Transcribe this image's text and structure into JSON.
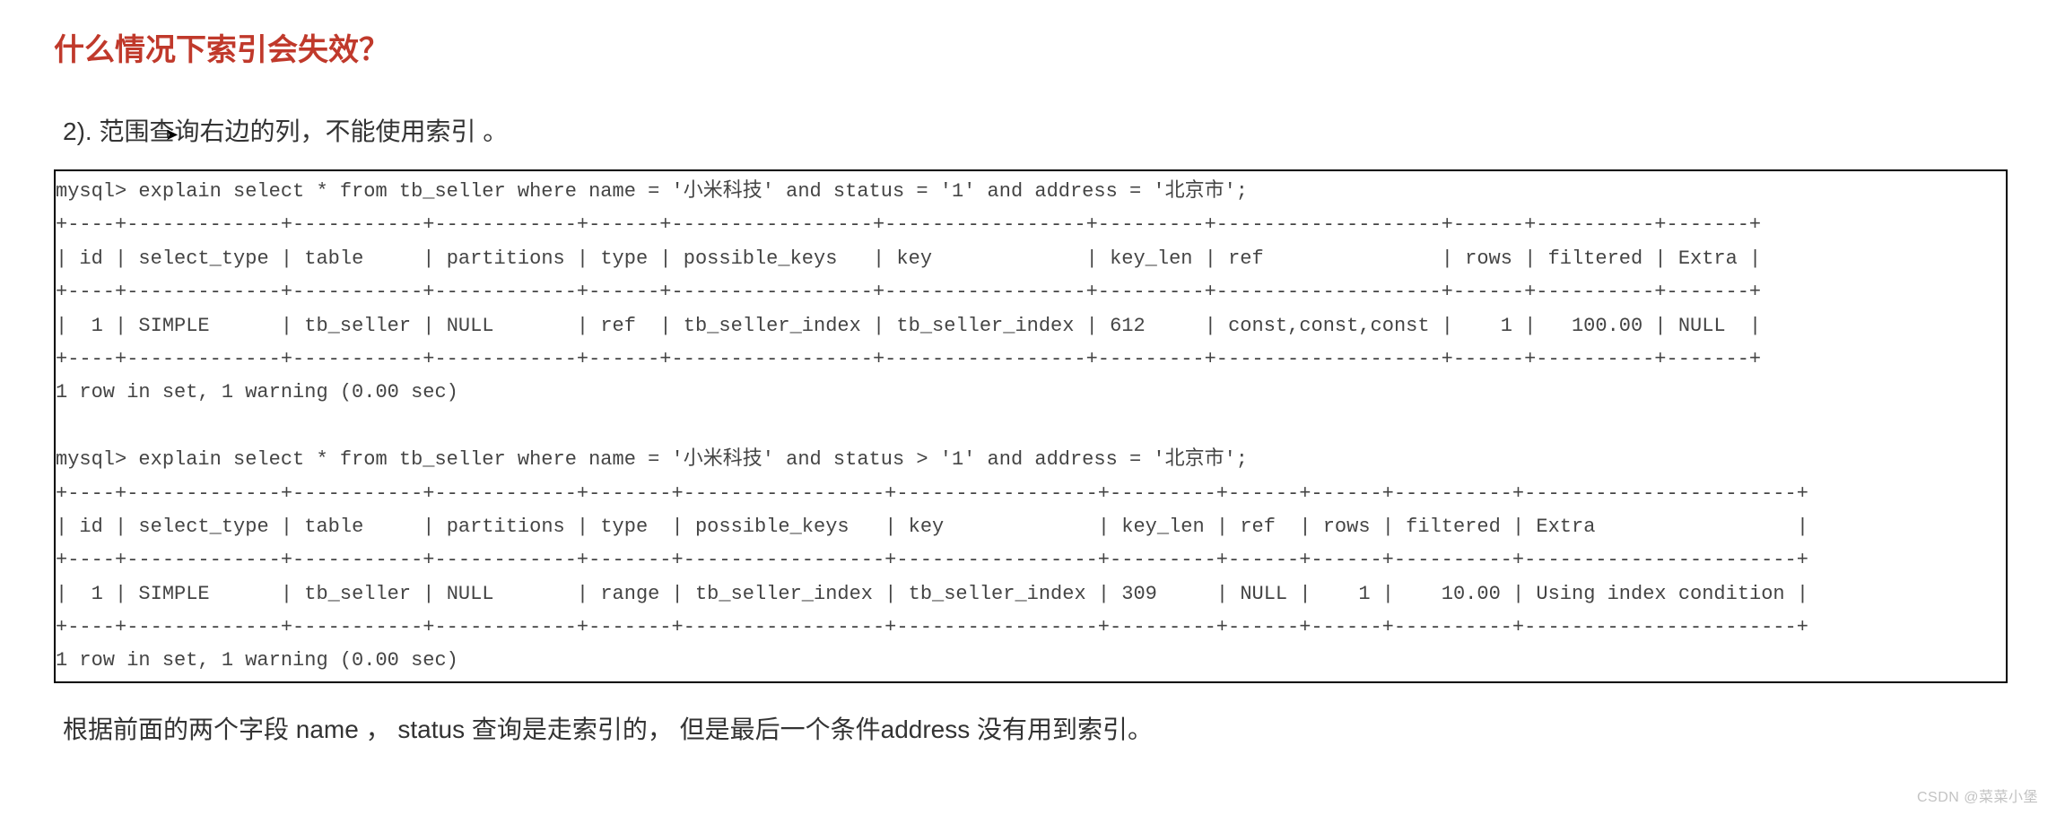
{
  "title": "什么情况下索引会失效？",
  "subtitle": "2). 范围查询右边的列，不能使用索引 。",
  "query1": {
    "prompt": "mysql> explain select * from tb_seller where name = '小米科技' and status = '1' and address = '北京市';",
    "headers": [
      "id",
      "select_type",
      "table",
      "partitions",
      "type",
      "possible_keys",
      "key",
      "key_len",
      "ref",
      "rows",
      "filtered",
      "Extra"
    ],
    "row": {
      "id": "1",
      "select_type": "SIMPLE",
      "table": "tb_seller",
      "partitions": "NULL",
      "type": "ref",
      "possible_keys": "tb_seller_index",
      "key": "tb_seller_index",
      "key_len": "612",
      "ref": "const,const,const",
      "rows": "1",
      "filtered": "100.00",
      "Extra": "NULL"
    },
    "footer": "1 row in set, 1 warning (0.00 sec)"
  },
  "query2": {
    "prompt": "mysql> explain select * from tb_seller where name = '小米科技' and status > '1' and address = '北京市';",
    "headers": [
      "id",
      "select_type",
      "table",
      "partitions",
      "type",
      "possible_keys",
      "key",
      "key_len",
      "ref",
      "rows",
      "filtered",
      "Extra"
    ],
    "row": {
      "id": "1",
      "select_type": "SIMPLE",
      "table": "tb_seller",
      "partitions": "NULL",
      "type": "range",
      "possible_keys": "tb_seller_index",
      "key": "tb_seller_index",
      "key_len": "309",
      "ref": "NULL",
      "rows": "1",
      "filtered": "10.00",
      "Extra": "Using index condition"
    },
    "footer": "1 row in set, 1 warning (0.00 sec)"
  },
  "explanation": "根据前面的两个字段 name ， status 查询是走索引的， 但是最后一个条件address 没有用到索引。",
  "watermark": "CSDN @菜菜小堡"
}
